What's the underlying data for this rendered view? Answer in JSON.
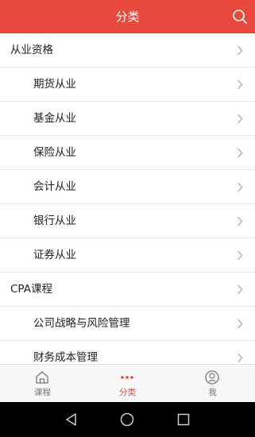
{
  "header": {
    "title": "分类",
    "search_icon": "search-icon"
  },
  "list": {
    "items": [
      {
        "label": "从业资格",
        "level": 0
      },
      {
        "label": "期货从业",
        "level": 1
      },
      {
        "label": "基金从业",
        "level": 1
      },
      {
        "label": "保险从业",
        "level": 1
      },
      {
        "label": "会计从业",
        "level": 1
      },
      {
        "label": "银行从业",
        "level": 1
      },
      {
        "label": "证券从业",
        "level": 1
      },
      {
        "label": "CPA课程",
        "level": 0
      },
      {
        "label": "公司战略与风险管理",
        "level": 1
      },
      {
        "label": "财务成本管理",
        "level": 1
      }
    ]
  },
  "tabbar": {
    "tabs": [
      {
        "label": "课程",
        "icon": "home-icon",
        "active": false
      },
      {
        "label": "分类",
        "icon": "more-dots-icon",
        "active": true
      },
      {
        "label": "我",
        "icon": "profile-icon",
        "active": false
      }
    ]
  },
  "colors": {
    "accent": "#e8493c",
    "tab_inactive": "#777777",
    "divider": "#e6e6e6"
  },
  "system_nav": {
    "icons": [
      "back-triangle-icon",
      "home-circle-icon",
      "recents-square-icon"
    ]
  }
}
